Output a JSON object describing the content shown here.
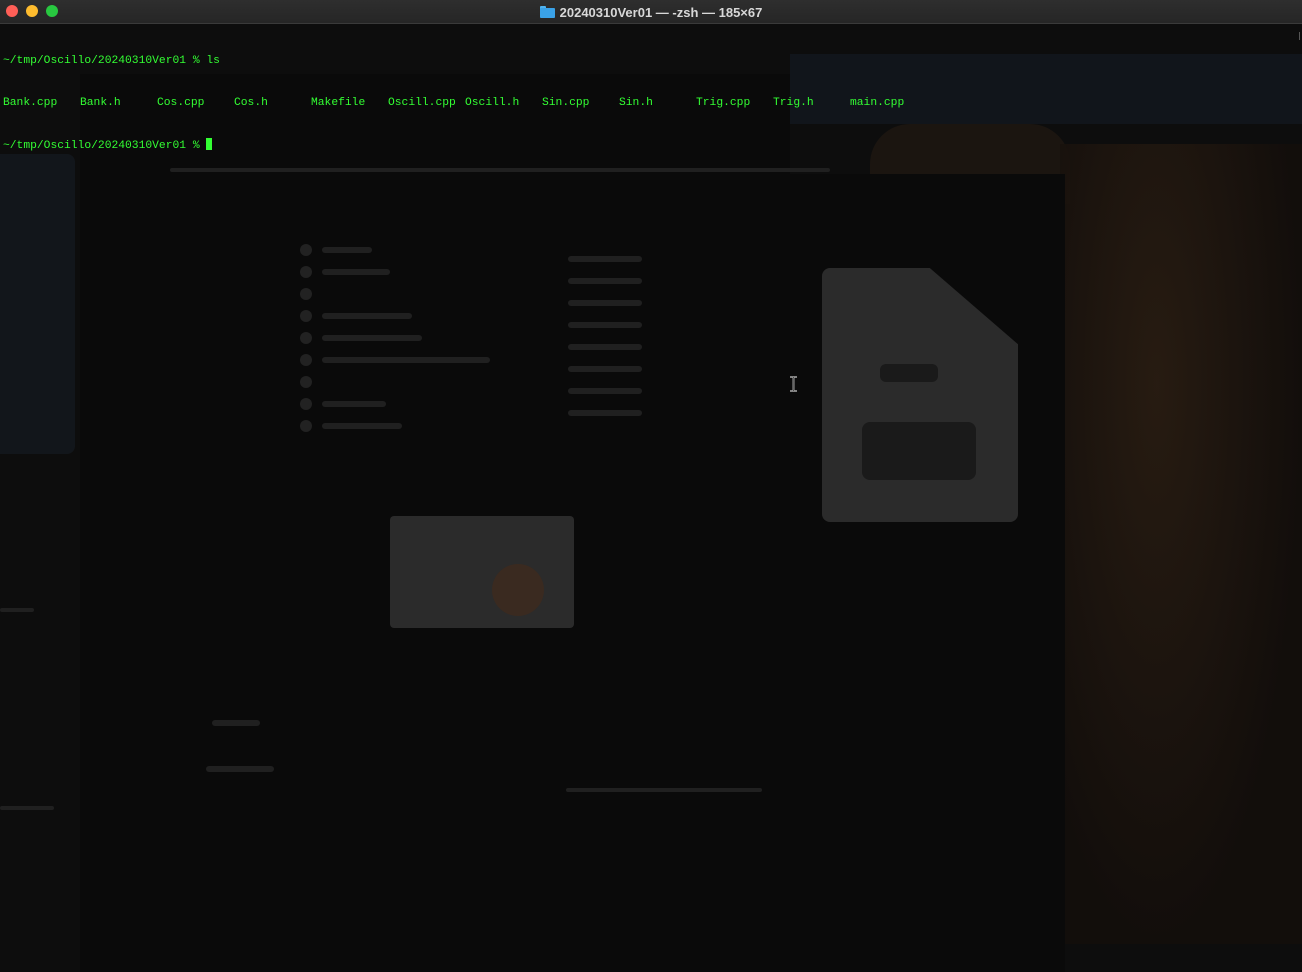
{
  "window": {
    "title": "20240310Ver01 — -zsh — 185×67",
    "title_icon": "folder-icon"
  },
  "terminal": {
    "prompt": "~/tmp/Oscillo/20240310Ver01 %",
    "command": "ls",
    "files": [
      "Bank.cpp",
      "Bank.h",
      "Cos.cpp",
      "Cos.h",
      "Makefile",
      "Oscill.cpp",
      "Oscill.h",
      "Sin.cpp",
      "Sin.h",
      "Trig.cpp",
      "Trig.h",
      "main.cpp"
    ],
    "text_color": "#33ff33"
  }
}
